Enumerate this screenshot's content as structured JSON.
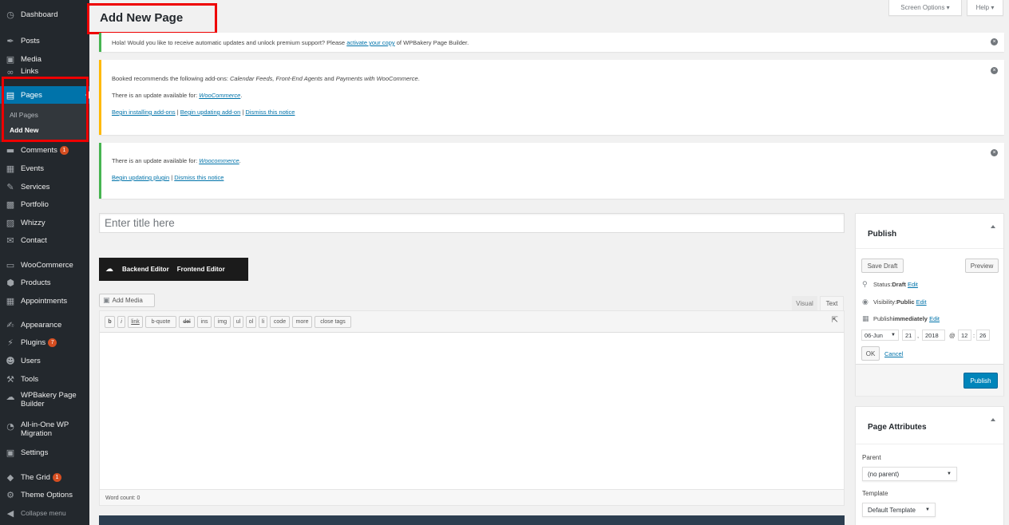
{
  "sidebar": {
    "items": [
      {
        "label": "Dashboard",
        "icon": "dashboard-icon",
        "glyph": "◷"
      },
      {
        "label": "Posts",
        "icon": "pin-icon",
        "glyph": "✒"
      },
      {
        "label": "Media",
        "icon": "media-icon",
        "glyph": "▣"
      },
      {
        "label": "Links",
        "icon": "link-icon",
        "glyph": "∞"
      },
      {
        "label": "Pages",
        "icon": "pages-icon",
        "glyph": "▤"
      },
      {
        "label": "Comments",
        "icon": "comments-icon",
        "glyph": "▬",
        "badge": "1"
      },
      {
        "label": "Events",
        "icon": "calendar-icon",
        "glyph": "▦"
      },
      {
        "label": "Services",
        "icon": "edit-icon",
        "glyph": "✎"
      },
      {
        "label": "Portfolio",
        "icon": "portfolio-icon",
        "glyph": "▩"
      },
      {
        "label": "Whizzy",
        "icon": "whizzy-icon",
        "glyph": "▨"
      },
      {
        "label": "Contact",
        "icon": "mail-icon",
        "glyph": "✉"
      },
      {
        "label": "WooCommerce",
        "icon": "woocommerce-icon",
        "glyph": "▭"
      },
      {
        "label": "Products",
        "icon": "products-icon",
        "glyph": "⬢"
      },
      {
        "label": "Appointments",
        "icon": "calendar-icon",
        "glyph": "▦"
      },
      {
        "label": "Appearance",
        "icon": "brush-icon",
        "glyph": "✍"
      },
      {
        "label": "Plugins",
        "icon": "plugin-icon",
        "glyph": "⚡",
        "badge": "7"
      },
      {
        "label": "Users",
        "icon": "users-icon",
        "glyph": "☻"
      },
      {
        "label": "Tools",
        "icon": "wrench-icon",
        "glyph": "⚒"
      },
      {
        "label": "WPBakery Page Builder",
        "icon": "wpbakery-icon",
        "glyph": "☁"
      },
      {
        "label": "All-in-One WP Migration",
        "icon": "migration-icon",
        "glyph": "◔"
      },
      {
        "label": "Settings",
        "icon": "settings-icon",
        "glyph": "▣"
      },
      {
        "label": "The Grid",
        "icon": "grid-icon",
        "glyph": "◆",
        "badge": "1"
      },
      {
        "label": "Theme Options",
        "icon": "gear-icon",
        "glyph": "⚙"
      },
      {
        "label": "Collapse menu",
        "icon": "collapse-icon",
        "glyph": "◀"
      }
    ],
    "submenu": [
      "All Pages",
      "Add New"
    ]
  },
  "header": {
    "title": "Add New Page",
    "screen_options": "Screen Options ▾",
    "help": "Help ▾"
  },
  "notices": {
    "n1_pre": "Hola! Would you like to receive automatic updates and unlock premium support? Please ",
    "n1_link": "activate your copy",
    "n1_post": " of WPBakery Page Builder.",
    "n2_l1_pre": "Booked recommends the following add-ons: ",
    "n2_l1_em": "Calendar Feeds, Front-End Agents",
    "n2_l1_and": " and ",
    "n2_l1_em2": "Payments with WooCommerce",
    "n2_l1_post": ".",
    "n2_l2_pre": "There is an update available for: ",
    "n2_l2_link": "WooCommerce",
    "n2_l2_post": ".",
    "n2_l3_a": "Begin installing add-ons",
    "n2_l3_b": "Begin updating add-on",
    "n2_l3_c": "Dismiss this notice",
    "sep": " | ",
    "n3_l1_pre": "There is an update available for: ",
    "n3_l1_link": "Woocommerce",
    "n3_l1_post": ".",
    "n3_l2_a": "Begin updating plugin",
    "n3_l2_b": "Dismiss this notice",
    "dismiss_glyph": "×"
  },
  "editor": {
    "title_placeholder": "Enter title here",
    "backend_editor": "Backend Editor",
    "frontend_editor": "Frontend Editor",
    "add_media": "Add Media",
    "tab_visual": "Visual",
    "tab_text": "Text",
    "quicktags": [
      "b",
      "i",
      "link",
      "b-quote",
      "del",
      "ins",
      "img",
      "ul",
      "ol",
      "li",
      "code",
      "more",
      "close tags"
    ],
    "word_count": "Word count: 0"
  },
  "publish": {
    "title": "Publish",
    "save_draft": "Save Draft",
    "preview": "Preview",
    "status_label": "Status: ",
    "status_value": "Draft",
    "visibility_label": "Visibility: ",
    "visibility_value": "Public",
    "publish_label": "Publish ",
    "publish_value": "immediately",
    "edit": "Edit",
    "month": "06-Jun",
    "day": "21",
    "year": "2018",
    "at": "@",
    "hour": "12",
    "minute": "26",
    "ok": "OK",
    "cancel": "Cancel",
    "publish_button": "Publish"
  },
  "attributes": {
    "title": "Page Attributes",
    "parent_label": "Parent",
    "parent_value": "(no parent)",
    "template_label": "Template",
    "template_value": "Default Template"
  },
  "colors": {
    "sidebar_bg": "#23282d",
    "accent": "#0073aa",
    "highlight": "#ee0000",
    "notice_success": "#46b450",
    "notice_warning": "#ffb900"
  }
}
